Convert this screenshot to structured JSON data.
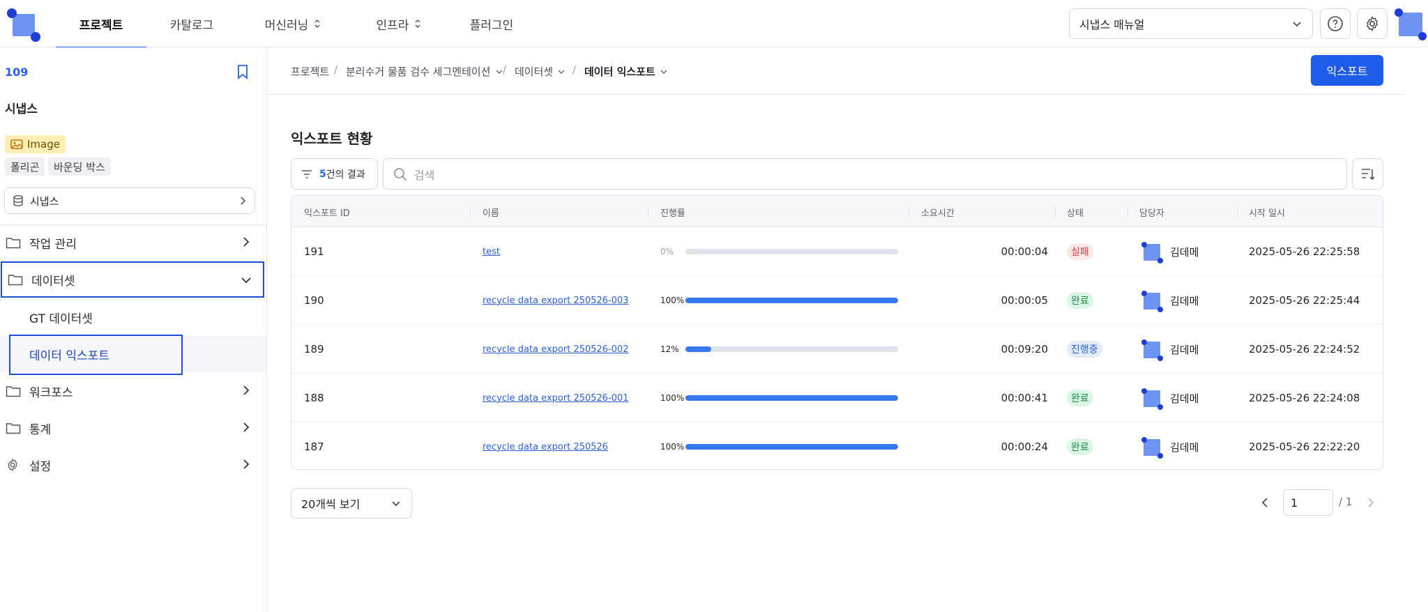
{
  "nav": {
    "tabs": [
      {
        "label": "프로젝트",
        "active": true
      },
      {
        "label": "카탈로그",
        "active": false
      },
      {
        "label": "머신러닝",
        "active": false
      },
      {
        "label": "인프라",
        "active": false
      },
      {
        "label": "플러그인",
        "active": false
      }
    ],
    "manual_select": "시냅스 매뉴얼",
    "help_icon": "help-circle-icon",
    "settings_icon": "gear-icon"
  },
  "sidebar": {
    "project_id": "109",
    "project_name": "시냅스",
    "type_badge": "Image",
    "tags": [
      "폴리곤",
      "바운딩 박스"
    ],
    "project_select": "시냅스",
    "menu": [
      {
        "label": "작업 관리",
        "icon": "folder-icon"
      },
      {
        "label": "데이터셋",
        "icon": "folder-icon",
        "expanded": true
      },
      {
        "label": "워크포스",
        "icon": "folder-icon"
      },
      {
        "label": "통계",
        "icon": "folder-icon"
      },
      {
        "label": "설정",
        "icon": "gear-icon"
      }
    ],
    "submenu": [
      {
        "label": "GT 데이터셋",
        "active": false
      },
      {
        "label": "데이터 익스포트",
        "active": true
      }
    ]
  },
  "breadcrumb": [
    "프로젝트",
    "분리수거 물품 검수 세그멘테이션",
    "데이터셋",
    "데이터 익스포트"
  ],
  "export_button": "익스포트",
  "section_title": "익스포트 현황",
  "filter": {
    "count": "5",
    "suffix": "건의 결과"
  },
  "search_placeholder": "검색",
  "table": {
    "columns": [
      "익스포트 ID",
      "이름",
      "진행률",
      "소요시간",
      "상태",
      "담당자",
      "시작 일시"
    ],
    "rows": [
      {
        "id": "191",
        "name": "test",
        "progress_label": "0%",
        "progress": 0.0,
        "duration": "00:00:04",
        "status": "실패",
        "status_kind": "fail",
        "owner": "김데메",
        "started": "2025-05-26 22:25:58"
      },
      {
        "id": "190",
        "name": "recycle data export 250526-003",
        "progress_label": "100%",
        "progress": 1.0,
        "duration": "00:00:05",
        "status": "완료",
        "status_kind": "done",
        "owner": "김데메",
        "started": "2025-05-26 22:25:44"
      },
      {
        "id": "189",
        "name": "recycle data export 250526-002",
        "progress_label": "12%",
        "progress": 0.12,
        "duration": "00:09:20",
        "status": "진행중",
        "status_kind": "run",
        "owner": "김데메",
        "started": "2025-05-26 22:24:52"
      },
      {
        "id": "188",
        "name": "recycle data export 250526-001",
        "progress_label": "100%",
        "progress": 1.0,
        "duration": "00:00:41",
        "status": "완료",
        "status_kind": "done",
        "owner": "김데메",
        "started": "2025-05-26 22:24:08"
      },
      {
        "id": "187",
        "name": "recycle data export 250526",
        "progress_label": "100%",
        "progress": 1.0,
        "duration": "00:00:24",
        "status": "완료",
        "status_kind": "done",
        "owner": "김데메",
        "started": "2025-05-26 22:22:20"
      }
    ]
  },
  "pagination": {
    "page_size": "20개씩 보기",
    "current": "1",
    "total": "/ 1"
  },
  "colors": {
    "accent": "#1d5be8",
    "progress": "#3578f0",
    "fail": "#d23b3b",
    "done": "#1d8a4a",
    "run": "#2b5fd9"
  }
}
